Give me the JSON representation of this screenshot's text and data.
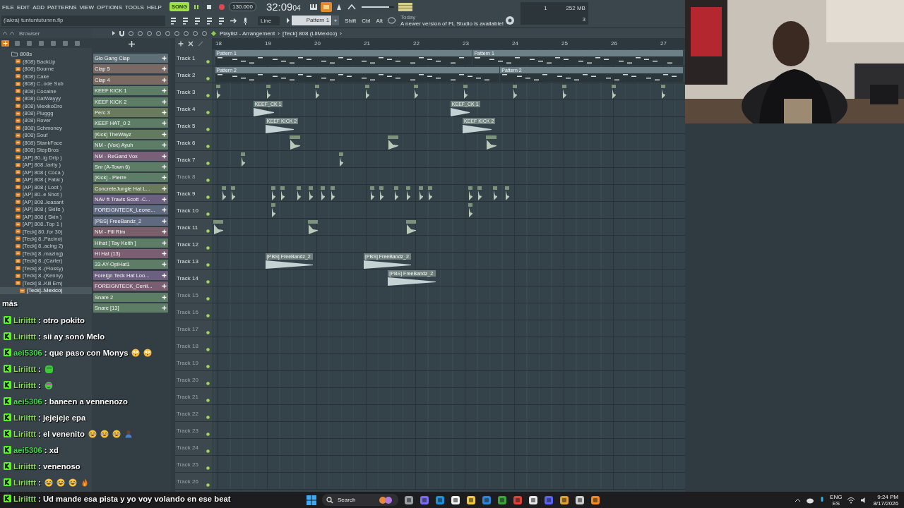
{
  "menu": [
    "FILE",
    "EDIT",
    "ADD",
    "PATTERNS",
    "VIEW",
    "OPTIONS",
    "TOOLS",
    "HELP"
  ],
  "transport": {
    "mode": "SONG",
    "song_mode": true,
    "playing": true,
    "tempo": "130.000",
    "time": "32:09",
    "ticks": "04"
  },
  "master_volume": {
    "level": 0.85
  },
  "monitor": {
    "cpu": "1",
    "memory": "252 MB",
    "polyphony": "3"
  },
  "hint": "(lakra) tuntuntutunnn.flp",
  "snap": "Line",
  "pattern": "Pattern 1",
  "pattern_add": "+",
  "modifiers": [
    "Shift",
    "Ctrl",
    "Alt"
  ],
  "news": {
    "date": "Today",
    "text": "A newer version of FL Studio is available!"
  },
  "browser": {
    "title": "Browser",
    "folder": "808s",
    "items": [
      {
        "label": "(808) BackUp",
        "selected": false
      },
      {
        "label": "(808) Bourne",
        "selected": false
      },
      {
        "label": "(808) Cake",
        "selected": false
      },
      {
        "label": "(808) C..ode Sub",
        "selected": false
      },
      {
        "label": "(808) Cocaine",
        "selected": false
      },
      {
        "label": "(808) DatWayyy",
        "selected": false
      },
      {
        "label": "(808) MexikoDro",
        "selected": false
      },
      {
        "label": "(808) Pluggg",
        "selected": false
      },
      {
        "label": "(808) Rover",
        "selected": false
      },
      {
        "label": "(808) Schmoney",
        "selected": false
      },
      {
        "label": "(808) Souf",
        "selected": false
      },
      {
        "label": "(808) StankFace",
        "selected": false
      },
      {
        "label": "(808) StepBros",
        "selected": false
      },
      {
        "label": "[AP] 80..ig Drip )",
        "selected": false
      },
      {
        "label": "[AP] 808..larity )",
        "selected": false
      },
      {
        "label": "[AP] 808 ( Coca )",
        "selected": false
      },
      {
        "label": "[AP] 808 ( Fatal )",
        "selected": false
      },
      {
        "label": "[AP] 808 ( Loot )",
        "selected": false
      },
      {
        "label": "[AP] 80..e Shot )",
        "selected": false
      },
      {
        "label": "[AP] 808..leasant",
        "selected": false
      },
      {
        "label": "[AP] 808 ( Skills )",
        "selected": false
      },
      {
        "label": "[AP] 808 ( Skin )",
        "selected": false
      },
      {
        "label": "[AP] 808..Top 1 )",
        "selected": false
      },
      {
        "label": "[Teck] 80..for 30)",
        "selected": false
      },
      {
        "label": "[Teck] 8..Pacino)",
        "selected": false
      },
      {
        "label": "[Teck] 8..acing 2)",
        "selected": false
      },
      {
        "label": "[Teck] 8..mazing)",
        "selected": false
      },
      {
        "label": "[Teck] 8..(Carter)",
        "selected": false
      },
      {
        "label": "[Teck] 8..(Flossy)",
        "selected": false
      },
      {
        "label": "[Teck] 8..(Kenny)",
        "selected": false
      },
      {
        "label": "[Teck] 8..Kill Em)",
        "selected": false
      },
      {
        "label": "[Teck]..Mexico)",
        "selected": true
      }
    ]
  },
  "channels": [
    {
      "name": "Glo Gang Clap",
      "color": "#5f6f78"
    },
    {
      "name": "Clap 5",
      "color": "#7a6a66"
    },
    {
      "name": "Clap 4",
      "color": "#7a6a62"
    },
    {
      "name": "KEEF KICK 1",
      "color": "#5d7d66"
    },
    {
      "name": "KEEF KICK 2",
      "color": "#5d7d66"
    },
    {
      "name": "Perc 3",
      "color": "#6a7a5c"
    },
    {
      "name": "KEEF HAT_0 2",
      "color": "#5d7d66"
    },
    {
      "name": "[Kick] TheWayz",
      "color": "#627a60"
    },
    {
      "name": "NM - (Vox) Ayuh",
      "color": "#5d7d66"
    },
    {
      "name": "NM - ReGand Vox",
      "color": "#7a5f78"
    },
    {
      "name": "Snr (A-Town 6)",
      "color": "#5d7d66"
    },
    {
      "name": "[Kick] - Pierre",
      "color": "#5d7d66"
    },
    {
      "name": "ConcreteJungle Hat L...",
      "color": "#6a7a5c"
    },
    {
      "name": "NAV ft Travis Scott -C...",
      "color": "#6c6080"
    },
    {
      "name": "FOREIGNTECK_Leone...",
      "color": "#5f6a80"
    },
    {
      "name": "[PBS] FreeBandz_2",
      "color": "#5f6a80"
    },
    {
      "name": "NM - Fill Rim",
      "color": "#7a5f6a"
    },
    {
      "name": "Hihat [ Tay Keith ]",
      "color": "#5d7d66"
    },
    {
      "name": "Hi Hat (13)",
      "color": "#7a5f72"
    },
    {
      "name": "33-AY-OpiHat1",
      "color": "#5d7d66"
    },
    {
      "name": "Foreign Teck Hat Loo...",
      "color": "#6c6080"
    },
    {
      "name": "FOREIGNTECK_Cenli...",
      "color": "#7a5f72"
    },
    {
      "name": "Snare 2",
      "color": "#5d7d66"
    },
    {
      "name": "Snare [13]",
      "color": "#5d7d66"
    }
  ],
  "playlist": {
    "path": [
      "Playlist - Arrangement",
      "›",
      "[Teck] 808 (LilMexico)",
      "›"
    ],
    "bars": [
      "18",
      "19",
      "20",
      "21",
      "22",
      "23",
      "24",
      "25",
      "26",
      "27"
    ],
    "tracks": [
      {
        "name": "Track 1",
        "dim": false,
        "clips": [
          {
            "kind": "pattern",
            "label": "Pattern 1"
          },
          {
            "kind": "pattern",
            "label": "Pattern 1"
          }
        ]
      },
      {
        "name": "Track 2",
        "dim": false,
        "clips": [
          {
            "kind": "pattern",
            "label": "Pattern 2"
          },
          {
            "kind": "pattern",
            "label": "Pattern 2"
          }
        ]
      },
      {
        "name": "Track 3",
        "dim": false
      },
      {
        "name": "Track 4",
        "dim": false,
        "clips": [
          {
            "kind": "audio",
            "label": "KEEF_CK 1"
          },
          {
            "kind": "audio",
            "label": "KEEF_CK 1"
          }
        ]
      },
      {
        "name": "Track 5",
        "dim": false,
        "clips": [
          {
            "kind": "audio",
            "label": "KEEF KICK 2"
          },
          {
            "kind": "audio",
            "label": "KEEF KICK 2"
          }
        ]
      },
      {
        "name": "Track 6",
        "dim": false
      },
      {
        "name": "Track 7",
        "dim": false
      },
      {
        "name": "Track 8",
        "dim": true
      },
      {
        "name": "Track 9",
        "dim": false
      },
      {
        "name": "Track 10",
        "dim": false
      },
      {
        "name": "Track 11",
        "dim": false
      },
      {
        "name": "Track 12",
        "dim": false
      },
      {
        "name": "Track 13",
        "dim": false,
        "clips": [
          {
            "kind": "audio",
            "label": "[PBS] FreeBandz_2"
          },
          {
            "kind": "audio",
            "label": "[PBS] FreeBandz_2"
          }
        ]
      },
      {
        "name": "Track 14",
        "dim": false,
        "clips": [
          {
            "kind": "audio",
            "label": "[PBS] FreeBandz_2"
          }
        ]
      },
      {
        "name": "Track 15",
        "dim": true
      },
      {
        "name": "Track 16",
        "dim": true
      },
      {
        "name": "Track 17",
        "dim": true
      },
      {
        "name": "Track 18",
        "dim": true
      },
      {
        "name": "Track 19",
        "dim": true
      },
      {
        "name": "Track 20",
        "dim": true
      },
      {
        "name": "Track 21",
        "dim": true
      },
      {
        "name": "Track 22",
        "dim": true
      },
      {
        "name": "Track 23",
        "dim": true
      },
      {
        "name": "Track 24",
        "dim": true
      },
      {
        "name": "Track 25",
        "dim": true
      },
      {
        "name": "Track 26",
        "dim": true
      }
    ]
  },
  "chat": {
    "header": "más",
    "messages": [
      {
        "user": "Liriittt",
        "color": "#8be05a",
        "text": ": otro pokito"
      },
      {
        "user": "Liriittt",
        "color": "#8be05a",
        "text": ": sii ay sonó Melo"
      },
      {
        "user": "aei5306",
        "color": "#45d84e",
        "text": ": que paso con Monys",
        "emotes": [
          {
            "kind": "flushed"
          },
          {
            "kind": "flushed"
          }
        ]
      },
      {
        "user": "Liriittt",
        "color": "#8be05a",
        "text": ":",
        "emotes": [
          {
            "kind": "blob"
          }
        ]
      },
      {
        "user": "Liriittt",
        "color": "#8be05a",
        "text": ":",
        "emotes": [
          {
            "kind": "frog"
          }
        ]
      },
      {
        "user": "aei5306",
        "color": "#45d84e",
        "text": ": baneen a vennenozo"
      },
      {
        "user": "Liriittt",
        "color": "#8be05a",
        "text": ": jejejeje epa"
      },
      {
        "user": "Liriittt",
        "color": "#8be05a",
        "text": ": el venenito",
        "emotes": [
          {
            "kind": "laughing"
          },
          {
            "kind": "laughing"
          },
          {
            "kind": "laughing"
          },
          {
            "kind": "person"
          }
        ]
      },
      {
        "user": "aei5306",
        "color": "#45d84e",
        "text": ": xd"
      },
      {
        "user": "Liriittt",
        "color": "#8be05a",
        "text": ": venenoso"
      },
      {
        "user": "Liriittt",
        "color": "#8be05a",
        "text": ":",
        "emotes": [
          {
            "kind": "laughing"
          },
          {
            "kind": "laughing"
          },
          {
            "kind": "laughing"
          },
          {
            "kind": "fire"
          }
        ]
      },
      {
        "user": "Liriittt",
        "color": "#8be05a",
        "text": ": Ud mande esa pista y yo voy volando en ese beat"
      }
    ]
  },
  "taskbar": {
    "search": "Search",
    "language": "ENG",
    "region": "ES",
    "time": "9:24 PM",
    "date": "8/17/2026"
  }
}
